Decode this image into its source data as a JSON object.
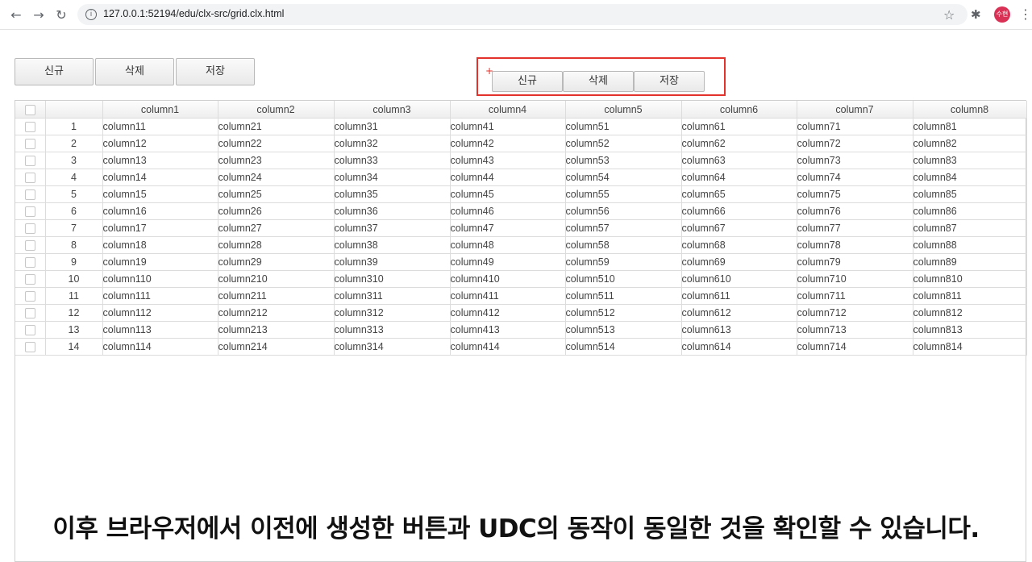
{
  "browser": {
    "url": "127.0.0.1:52194/edu/clx-src/grid.clx.html",
    "avatar_text": "수현"
  },
  "left_buttons": [
    "신규",
    "삭제",
    "저장"
  ],
  "udc_buttons": [
    "신규",
    "삭제",
    "저장"
  ],
  "grid": {
    "headers": [
      "",
      "",
      "column1",
      "column2",
      "column3",
      "column4",
      "column5",
      "column6",
      "column7",
      "column8"
    ],
    "rows": [
      [
        "1",
        "column11",
        "column21",
        "column31",
        "column41",
        "column51",
        "column61",
        "column71",
        "column81"
      ],
      [
        "2",
        "column12",
        "column22",
        "column32",
        "column42",
        "column52",
        "column62",
        "column72",
        "column82"
      ],
      [
        "3",
        "column13",
        "column23",
        "column33",
        "column43",
        "column53",
        "column63",
        "column73",
        "column83"
      ],
      [
        "4",
        "column14",
        "column24",
        "column34",
        "column44",
        "column54",
        "column64",
        "column74",
        "column84"
      ],
      [
        "5",
        "column15",
        "column25",
        "column35",
        "column45",
        "column55",
        "column65",
        "column75",
        "column85"
      ],
      [
        "6",
        "column16",
        "column26",
        "column36",
        "column46",
        "column56",
        "column66",
        "column76",
        "column86"
      ],
      [
        "7",
        "column17",
        "column27",
        "column37",
        "column47",
        "column57",
        "column67",
        "column77",
        "column87"
      ],
      [
        "8",
        "column18",
        "column28",
        "column38",
        "column48",
        "column58",
        "column68",
        "column78",
        "column88"
      ],
      [
        "9",
        "column19",
        "column29",
        "column39",
        "column49",
        "column59",
        "column69",
        "column79",
        "column89"
      ],
      [
        "10",
        "column110",
        "column210",
        "column310",
        "column410",
        "column510",
        "column610",
        "column710",
        "column810"
      ],
      [
        "11",
        "column111",
        "column211",
        "column311",
        "column411",
        "column511",
        "column611",
        "column711",
        "column811"
      ],
      [
        "12",
        "column112",
        "column212",
        "column312",
        "column412",
        "column512",
        "column612",
        "column712",
        "column812"
      ],
      [
        "13",
        "column113",
        "column213",
        "column313",
        "column413",
        "column513",
        "column613",
        "column713",
        "column813"
      ],
      [
        "14",
        "column114",
        "column214",
        "column314",
        "column414",
        "column514",
        "column614",
        "column714",
        "column814"
      ]
    ]
  },
  "caption": "이후 브라우저에서 이전에 생성한 버튼과 UDC의 동작이 동일한 것을 확인할 수 있습니다.",
  "colors": {
    "accent_box": "#e3322b",
    "avatar": "#d93156"
  },
  "icons": [
    "back-icon",
    "forward-icon",
    "reload-icon",
    "info-icon",
    "star-icon",
    "extensions-icon",
    "menu-icon",
    "plus-icon"
  ]
}
